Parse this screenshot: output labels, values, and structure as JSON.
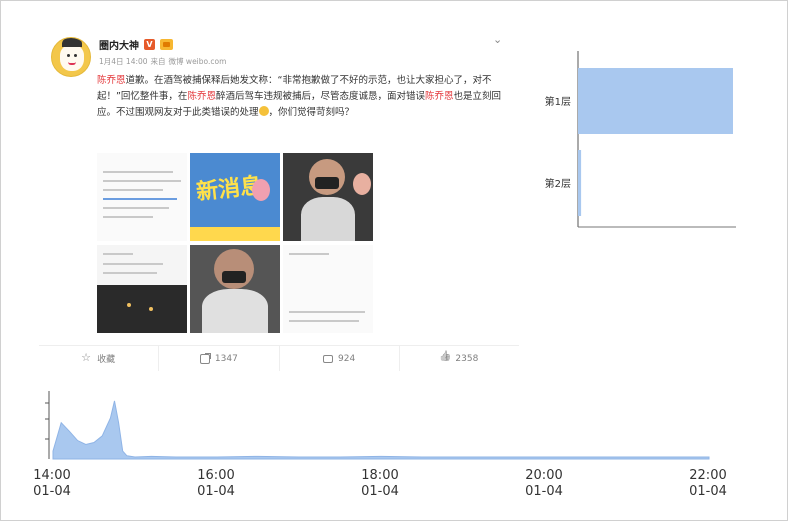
{
  "post": {
    "username": "圈内大神",
    "date": "1月4日 14:00",
    "source_prefix": "来自",
    "source": "微博 weibo.com",
    "text_segments": [
      {
        "t": "陈乔恩",
        "hl": true
      },
      {
        "t": "道歉。在酒驾被捕保释后她发文称：“非常抱歉做了不好的示范，也让大家担心了，对不起！”回忆整件事，在",
        "hl": false
      },
      {
        "t": "陈乔恩",
        "hl": true
      },
      {
        "t": "醉酒后驾车违规被捕后，尽管态度诚恳，面对错误",
        "hl": false
      },
      {
        "t": "陈乔恩",
        "hl": true
      },
      {
        "t": "也是立刻回应。不过围观网友对于此类错误的处理",
        "hl": false
      },
      {
        "t": "，你们觉得苛刻吗？",
        "hl": false
      }
    ],
    "image_text": "新消息",
    "actions": [
      {
        "label": "收藏",
        "icon": "star-icon"
      },
      {
        "label": "1347",
        "icon": "share-icon"
      },
      {
        "label": "924",
        "icon": "comment-icon"
      },
      {
        "label": "2358",
        "icon": "like-icon"
      }
    ]
  },
  "chart_data": [
    {
      "type": "bar",
      "orientation": "horizontal",
      "categories": [
        "第1层",
        "第2层"
      ],
      "values": [
        100,
        2
      ],
      "color": "#a9c8ef"
    },
    {
      "type": "area",
      "x_ticks": [
        {
          "time": "14:00",
          "date": "01-04"
        },
        {
          "time": "16:00",
          "date": "01-04"
        },
        {
          "time": "18:00",
          "date": "01-04"
        },
        {
          "time": "20:00",
          "date": "01-04"
        },
        {
          "time": "22:00",
          "date": "01-04"
        }
      ],
      "x_hours": [
        14.0,
        14.1,
        14.2,
        14.3,
        14.4,
        14.5,
        14.6,
        14.7,
        14.75,
        14.8,
        14.85,
        14.9,
        15.0,
        15.2,
        15.5,
        16.0,
        16.5,
        17.0,
        17.5,
        18.0,
        18.5,
        19.0,
        19.5,
        20.0,
        20.5,
        21.0,
        21.5,
        22.0
      ],
      "y_values": [
        0.12,
        0.55,
        0.42,
        0.28,
        0.22,
        0.25,
        0.35,
        0.62,
        0.88,
        0.55,
        0.12,
        0.05,
        0.03,
        0.04,
        0.03,
        0.03,
        0.04,
        0.03,
        0.03,
        0.04,
        0.03,
        0.03,
        0.03,
        0.03,
        0.03,
        0.03,
        0.03,
        0.03
      ],
      "ylim": [
        0,
        1
      ],
      "color": "#a9c8ef"
    }
  ]
}
